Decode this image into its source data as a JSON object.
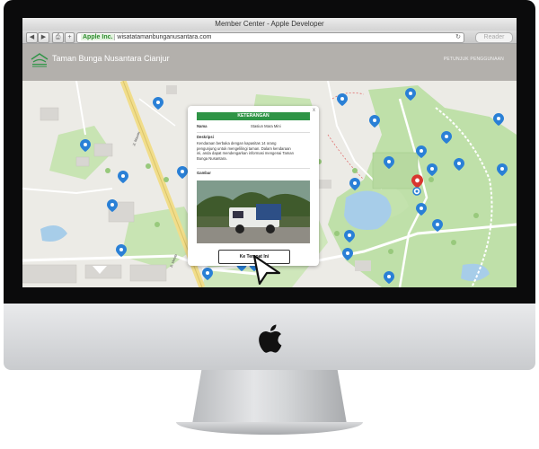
{
  "window": {
    "title": "Member Center - Apple Developer"
  },
  "browser": {
    "back": "◀",
    "forward": "▶",
    "share": "⎙",
    "plus": "+",
    "secure_label": "Apple Inc.",
    "url": "wisatatamanbunganusantara.com",
    "reload_icon": "reload-icon",
    "reader_label": "Reader"
  },
  "site": {
    "title": "Taman Bunga Nusantara Cianjur",
    "help_link": "PETUNJUK PENGGUNAAN",
    "logo_text": "TAMAN BUNGA NUSANTARA"
  },
  "map": {
    "road_labels": [
      "Jl. Mawar",
      "Jl. Melati"
    ]
  },
  "popup": {
    "header": "KETERANGAN",
    "close": "x",
    "name_label": "Nama",
    "name_value": "Stasiun Mara Mini",
    "description_label": "Deskripsi",
    "description_text": "Kendaraan berbaka dengan kapasitas 14 orang pengunjung untuk mengelilingi taman. Dalam kendaraan ini, anda dapat mendengarkan informasi mengenai Taman Bunga Nusantara.",
    "image_label": "Gambar",
    "button_label": "Ke Tempat Ini"
  },
  "colors": {
    "header_bg": "#b3b0ac",
    "popup_header": "#2f9446",
    "pin_blue": "#2a80d6",
    "pin_red": "#d9362f",
    "park_green": "#bfe0a9",
    "water": "#a7cde9"
  }
}
